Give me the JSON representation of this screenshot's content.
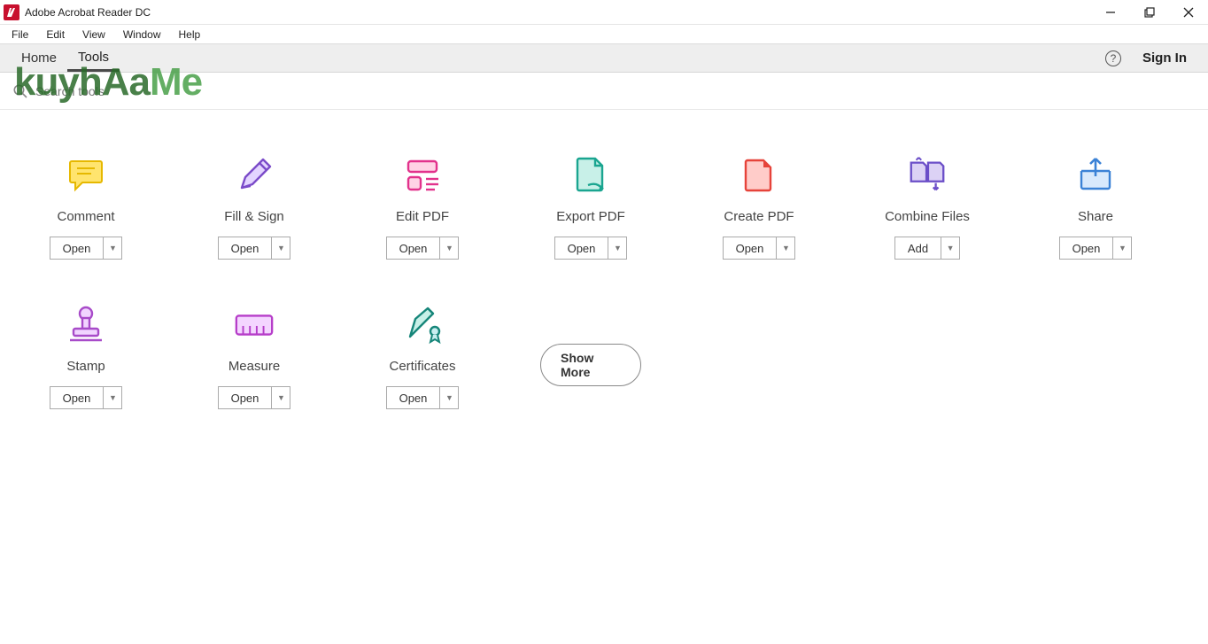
{
  "window": {
    "title": "Adobe Acrobat Reader DC"
  },
  "menubar": [
    "File",
    "Edit",
    "View",
    "Window",
    "Help"
  ],
  "tabs": {
    "home": "Home",
    "tools": "Tools",
    "signin": "Sign In"
  },
  "search": {
    "placeholder": "Search tools"
  },
  "watermark": {
    "a": "kuyhAa",
    "b": "Me"
  },
  "tools_row1": [
    {
      "label": "Comment",
      "btn": "Open"
    },
    {
      "label": "Fill & Sign",
      "btn": "Open"
    },
    {
      "label": "Edit PDF",
      "btn": "Open"
    },
    {
      "label": "Export PDF",
      "btn": "Open"
    },
    {
      "label": "Create PDF",
      "btn": "Open"
    },
    {
      "label": "Combine Files",
      "btn": "Add"
    },
    {
      "label": "Share",
      "btn": "Open"
    }
  ],
  "tools_row2": [
    {
      "label": "Stamp",
      "btn": "Open"
    },
    {
      "label": "Measure",
      "btn": "Open"
    },
    {
      "label": "Certificates",
      "btn": "Open"
    }
  ],
  "show_more": "Show More"
}
